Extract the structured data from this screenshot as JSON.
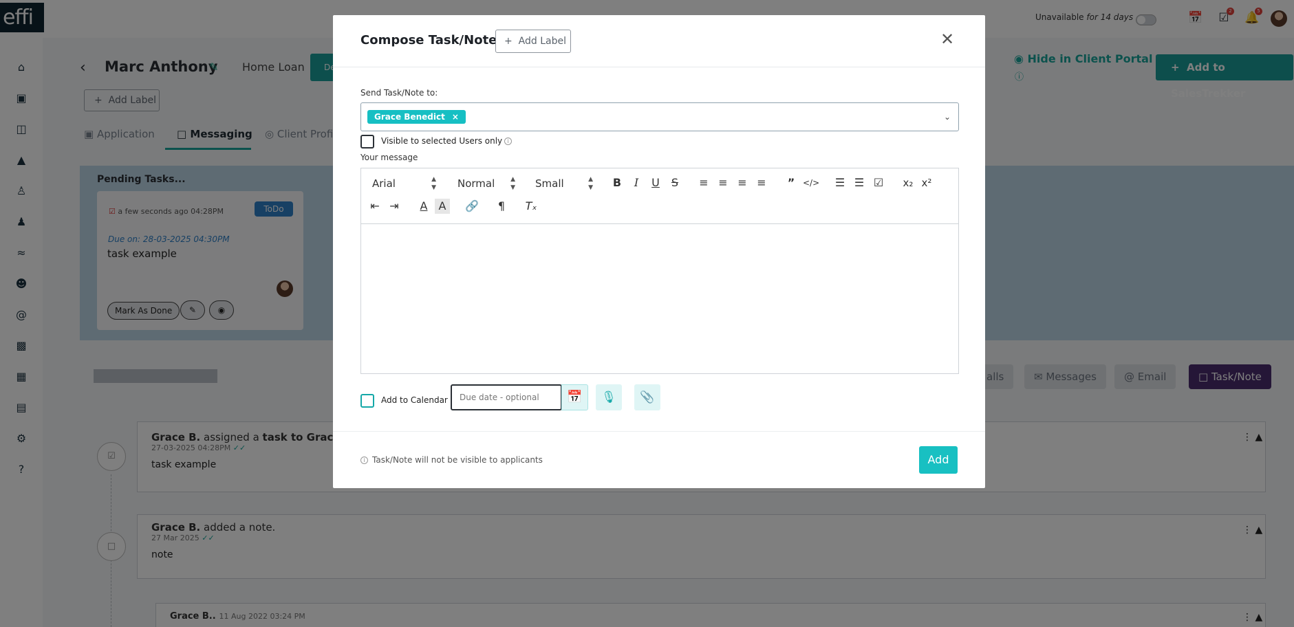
{
  "app": {
    "logo": "effi",
    "status": {
      "label": "Unavailable",
      "duration": "for 14 days"
    },
    "badges": {
      "tasks": "2",
      "notifications": "5"
    }
  },
  "background": {
    "client_name": "Marc Anthony",
    "loan_type": "Home Loan",
    "stage_button": "De",
    "add_label": "Add Label",
    "tabs": [
      "Application",
      "Messaging",
      "Client Profi"
    ],
    "hide_portal": "Hide in Client Portal",
    "add_salestrekker": "Add to SalesTrekker",
    "pending_title": "Pending Tasks...",
    "task_card": {
      "meta": "a few seconds ago 04:28PM",
      "status": "ToDo",
      "due": "Due on: 28-03-2025 04:30PM",
      "name": "task example",
      "mark_done": "Mark As Done"
    },
    "filters": [
      "alls",
      "Messages",
      "Email",
      "Task/Note"
    ],
    "feed": [
      {
        "author": "Grace B.",
        "action": "assigned a",
        "object": "task to Grace Bene",
        "date": "27-03-2025 04:28PM",
        "body": "task example"
      },
      {
        "author": "Grace B.",
        "action": "added a",
        "object": "note.",
        "date": "27 Mar 2025",
        "body": "note"
      },
      {
        "author": "Grace B..",
        "action": "",
        "object": "",
        "date": "11 Aug 2022 03:24 PM",
        "body": ""
      }
    ]
  },
  "modal": {
    "title": "Compose Task/Note",
    "add_label": "Add Label",
    "send_to_label": "Send Task/Note to:",
    "recipient": "Grace Benedict",
    "visible_only_label": "Visible to selected Users only",
    "message_label": "Your message",
    "toolbar": {
      "font": "Arial",
      "heading": "Normal",
      "size": "Small"
    },
    "add_to_calendar": "Add to Calendar",
    "due_placeholder": "Due date - optional",
    "footer_note": "Task/Note will not be visible to applicants",
    "add_button": "Add"
  }
}
